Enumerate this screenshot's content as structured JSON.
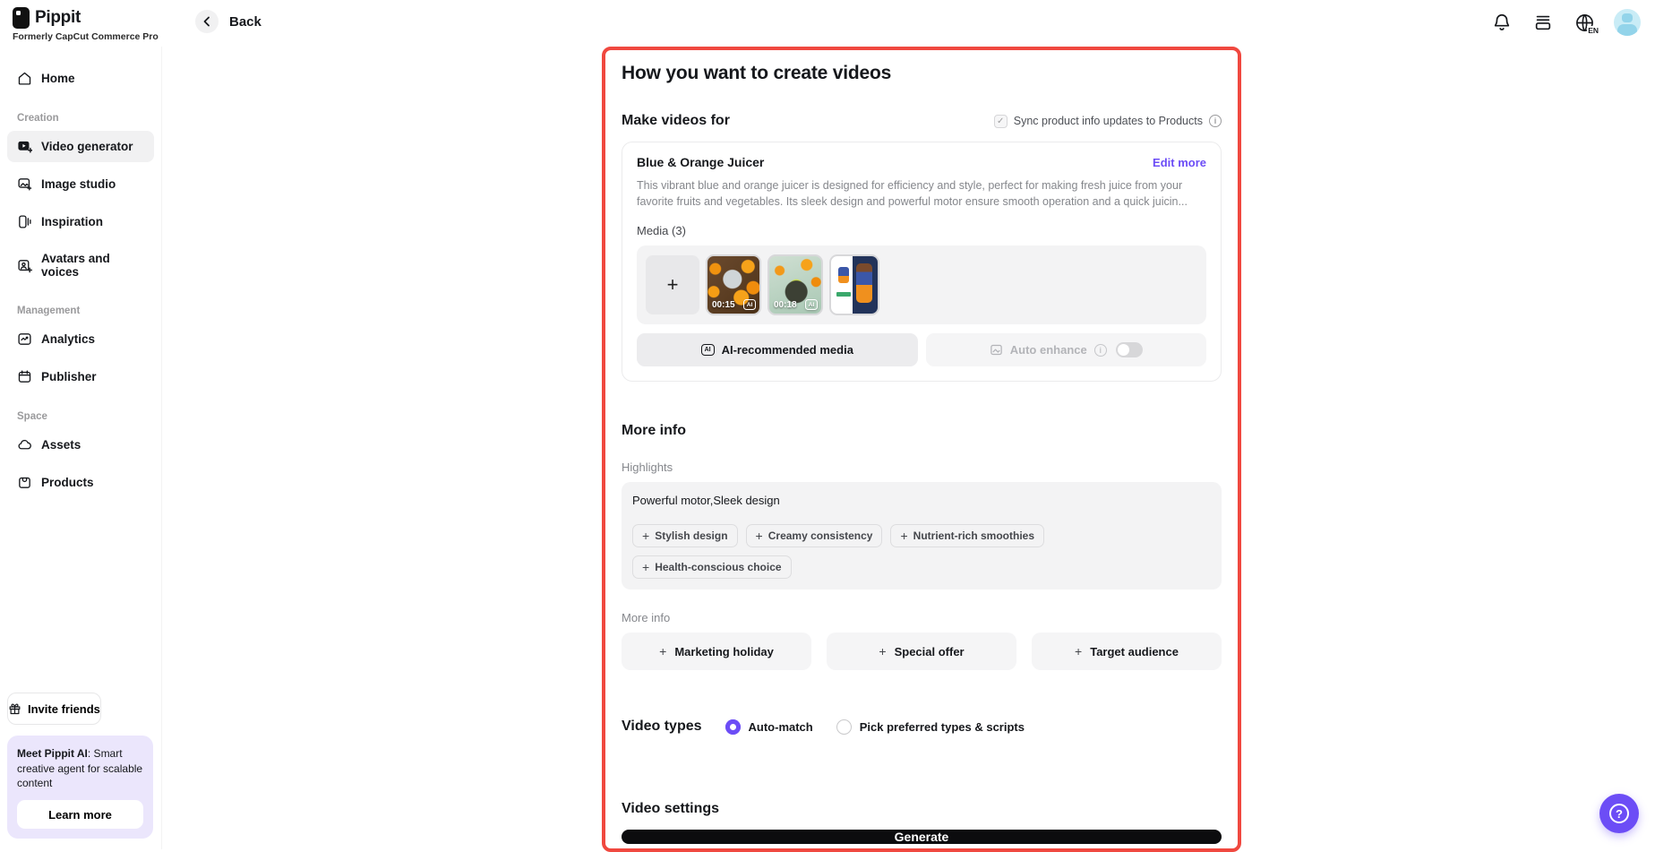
{
  "brand": {
    "name": "Pippit",
    "tagline": "Formerly CapCut Commerce Pro"
  },
  "topbar": {
    "back_label": "Back",
    "language": "EN"
  },
  "sidebar": {
    "home": {
      "label": "Home"
    },
    "creation_section": "Creation",
    "creation": [
      {
        "label": "Video generator"
      },
      {
        "label": "Image studio"
      },
      {
        "label": "Inspiration"
      },
      {
        "label": "Avatars and voices"
      }
    ],
    "management_section": "Management",
    "management": [
      {
        "label": "Analytics"
      },
      {
        "label": "Publisher"
      }
    ],
    "space_section": "Space",
    "space": [
      {
        "label": "Assets"
      },
      {
        "label": "Products"
      }
    ],
    "invite_label": "Invite friends",
    "promo": {
      "title_bold": "Meet Pippit AI",
      "title_rest": ": Smart creative agent for scalable content",
      "cta": "Learn more"
    }
  },
  "main": {
    "title": "How you want to create videos",
    "make_videos_for": "Make videos for",
    "sync_label": "Sync product info updates to Products",
    "product": {
      "name": "Blue & Orange Juicer",
      "edit_more": "Edit more",
      "description": "This vibrant blue and orange juicer is designed for efficiency and style, perfect for making fresh juice from your favorite fruits and vegetables. Its sleek design and powerful motor ensure smooth operation and a quick juicin...",
      "media_label": "Media (3)",
      "media": [
        {
          "duration": "00:15",
          "badge": "AI"
        },
        {
          "duration": "00:18",
          "badge": "AI"
        }
      ],
      "ai_recommended": "AI-recommended media",
      "auto_enhance": "Auto enhance"
    },
    "more_info_title": "More info",
    "highlights_label": "Highlights",
    "highlights_value": "Powerful motor,Sleek design",
    "highlight_suggestions": [
      {
        "label": "Stylish design"
      },
      {
        "label": "Creamy consistency"
      },
      {
        "label": "Nutrient-rich smoothies"
      },
      {
        "label": "Health-conscious choice"
      }
    ],
    "more_info_label": "More info",
    "more_info_buttons": [
      {
        "label": "Marketing holiday"
      },
      {
        "label": "Special offer"
      },
      {
        "label": "Target audience"
      }
    ],
    "video_types_label": "Video types",
    "video_type_options": [
      {
        "label": "Auto-match",
        "selected": true
      },
      {
        "label": "Pick preferred types & scripts",
        "selected": false
      }
    ],
    "video_settings_label": "Video settings",
    "generate_label": "Generate"
  },
  "colors": {
    "accent": "#6c4df6",
    "panel_border": "#f0483f",
    "generate_bg": "#0c0c0e"
  }
}
